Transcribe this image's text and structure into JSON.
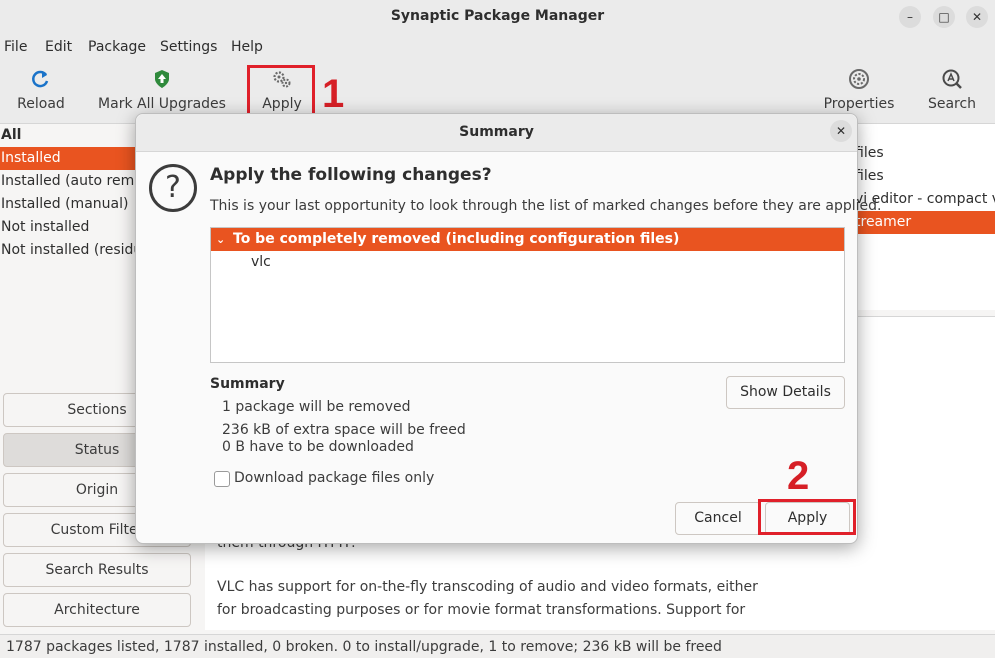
{
  "window": {
    "title": "Synaptic Package Manager"
  },
  "menu": [
    "File",
    "Edit",
    "Package",
    "Settings",
    "Help"
  ],
  "toolbar": {
    "reload": "Reload",
    "mark_all": "Mark All Upgrades",
    "apply": "Apply",
    "properties": "Properties",
    "search": "Search"
  },
  "annotations": {
    "step1": "1",
    "step2": "2",
    "color": "#e0202a"
  },
  "filters": [
    "All",
    "Installed",
    "Installed (auto remo",
    "Installed (manual)",
    "Not installed",
    "Not installed (residu"
  ],
  "left_buttons": [
    "Sections",
    "Status",
    "Origin",
    "Custom Filter",
    "Search Results",
    "Architecture"
  ],
  "package_rows": [
    "files",
    "files",
    "vi editor - compact v",
    "treamer"
  ],
  "description": {
    "lines": [
      "them through HTTP.",
      "VLC has support for on-the-fly transcoding of audio and video formats, either",
      "for broadcasting purposes or for movie format transformations. Support for"
    ]
  },
  "dialog": {
    "title": "Summary",
    "heading": "Apply the following changes?",
    "subtitle": "This is your last opportunity to look through the list of marked changes before they are applied.",
    "change_group": "To be completely removed (including configuration files)",
    "change_items": [
      "vlc"
    ],
    "summary_label": "Summary",
    "summary_lines": [
      "1 package will be removed",
      "236 kB of extra space will be freed",
      "0  B have to be downloaded"
    ],
    "show_details": "Show Details",
    "download_only": "Download package files only",
    "cancel": "Cancel",
    "apply": "Apply"
  },
  "statusbar": "1787 packages listed, 1787 installed, 0 broken. 0 to install/upgrade, 1 to remove; 236 kB will be freed",
  "colors": {
    "accent": "#e95420",
    "highlight_box": "#e0202a"
  }
}
